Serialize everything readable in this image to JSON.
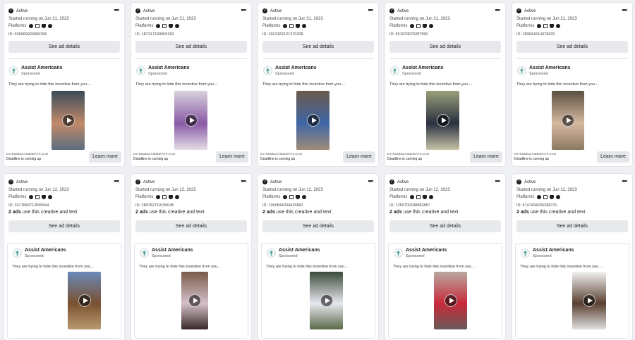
{
  "common": {
    "status": "Active",
    "platforms_label": "Platforms",
    "see_details": "See ad details",
    "page_name": "Assist Americans",
    "sponsored": "Sponsored",
    "body_row1": "They are trying to hide this incentive from you....",
    "body_row2": "They are trying to hide this incentive from you....",
    "link_domain": "EXTRAWEALTHBENEFITS.COM",
    "link_title": "Deadline is coming up",
    "cta": "Learn more",
    "uses_count": "2 ads",
    "uses_text": "use this creative and text",
    "more_glyph": "•••"
  },
  "cards": [
    {
      "started": "Started running on Jun 21, 2023",
      "id": "ID: 936969920900306",
      "media": [
        "#3a4b5a",
        "#c28a6a",
        "#5a6d7e"
      ]
    },
    {
      "started": "Started running on Jun 21, 2023",
      "id": "ID: 187317190969150",
      "media": [
        "#d9d2dc",
        "#8a5aa6",
        "#e4dde6"
      ]
    },
    {
      "started": "Started running on Jun 21, 2023",
      "id": "ID: 2023182121370208",
      "media": [
        "#6b5a4a",
        "#3e66a6",
        "#a08c78"
      ]
    },
    {
      "started": "Started running on Jun 21, 2023",
      "id": "ID: 651979970287990",
      "media": [
        "#9aa07a",
        "#2a3040",
        "#c8c4a8"
      ]
    },
    {
      "started": "Started running on Jun 21, 2023",
      "id": "ID: 283644314078200",
      "media": [
        "#5a5040",
        "#d7b8a0",
        "#8a7a60"
      ]
    },
    {
      "started": "Started running on Jun 12, 2023",
      "id": "ID: 2471580712595644",
      "media": [
        "#6a8ab8",
        "#7a5030",
        "#b89a70"
      ]
    },
    {
      "started": "Started running on Jun 12, 2023",
      "id": "ID: 289782710150045",
      "media": [
        "#7a5a4a",
        "#d4c0c8",
        "#3a2a28"
      ]
    },
    {
      "started": "Started running on Jun 12, 2023",
      "id": "ID: 1000844204415882",
      "media": [
        "#3a4a3a",
        "#e8e8f0",
        "#5a6a48"
      ]
    },
    {
      "started": "Started running on Jun 12, 2023",
      "id": "ID: 1250700188982887",
      "media": [
        "#b8a8a0",
        "#c82a3a",
        "#6a5a58"
      ]
    },
    {
      "started": "Started running on Jun 12, 2023",
      "id": "ID: 674749423526873​1",
      "media": [
        "#f2f2f2",
        "#5a4030",
        "#e0e0e0"
      ]
    }
  ]
}
